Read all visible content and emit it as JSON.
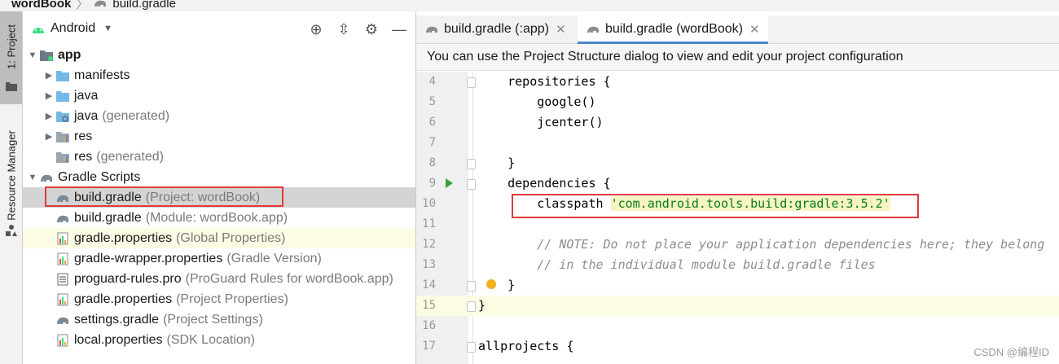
{
  "breadcrumb": {
    "project": "wordBook",
    "file": "build.gradle"
  },
  "toolstrip": {
    "project_tab": "1: Project",
    "resource_tab": "Resource Manager"
  },
  "project_panel": {
    "view_mode": "Android"
  },
  "tree": [
    {
      "label": "app",
      "note": "",
      "indent": 0,
      "arrow": "▼",
      "icon": "app-module-icon",
      "bold": true
    },
    {
      "label": "manifests",
      "note": "",
      "indent": 1,
      "arrow": "▶",
      "icon": "folder-icon"
    },
    {
      "label": "java",
      "note": "",
      "indent": 1,
      "arrow": "▶",
      "icon": "folder-icon"
    },
    {
      "label": "java",
      "note": "(generated)",
      "indent": 1,
      "arrow": "▶",
      "icon": "generated-folder-icon"
    },
    {
      "label": "res",
      "note": "",
      "indent": 1,
      "arrow": "▶",
      "icon": "res-folder-icon"
    },
    {
      "label": "res",
      "note": "(generated)",
      "indent": 1,
      "arrow": "",
      "icon": "res-folder-icon"
    },
    {
      "label": "Gradle Scripts",
      "note": "",
      "indent": 0,
      "arrow": "▼",
      "icon": "gradle-icon"
    },
    {
      "label": "build.gradle",
      "note": "(Project: wordBook)",
      "indent": 1,
      "arrow": "",
      "icon": "gradle-icon",
      "selected": true
    },
    {
      "label": "build.gradle",
      "note": "(Module: wordBook.app)",
      "indent": 1,
      "arrow": "",
      "icon": "gradle-icon"
    },
    {
      "label": "gradle.properties",
      "note": "(Global Properties)",
      "indent": 1,
      "arrow": "",
      "icon": "properties-icon",
      "highlight": true
    },
    {
      "label": "gradle-wrapper.properties",
      "note": "(Gradle Version)",
      "indent": 1,
      "arrow": "",
      "icon": "properties-icon"
    },
    {
      "label": "proguard-rules.pro",
      "note": "(ProGuard Rules for wordBook.app)",
      "indent": 1,
      "arrow": "",
      "icon": "file-icon"
    },
    {
      "label": "gradle.properties",
      "note": "(Project Properties)",
      "indent": 1,
      "arrow": "",
      "icon": "properties-icon"
    },
    {
      "label": "settings.gradle",
      "note": "(Project Settings)",
      "indent": 1,
      "arrow": "",
      "icon": "gradle-icon"
    },
    {
      "label": "local.properties",
      "note": "(SDK Location)",
      "indent": 1,
      "arrow": "",
      "icon": "properties-icon"
    }
  ],
  "editor": {
    "tabs": [
      {
        "label": "build.gradle (:app)",
        "active": false
      },
      {
        "label": "build.gradle (wordBook)",
        "active": true
      }
    ],
    "banner": "You can use the Project Structure dialog to view and edit your project configuration",
    "lines": [
      {
        "num": "4",
        "code": "    repositories {"
      },
      {
        "num": "5",
        "code": "        google()"
      },
      {
        "num": "6",
        "code": "        jcenter()"
      },
      {
        "num": "7",
        "code": ""
      },
      {
        "num": "8",
        "code": "    }"
      },
      {
        "num": "9",
        "code": "    dependencies {"
      },
      {
        "num": "10",
        "code": "        classpath ",
        "str": "'com.android.tools.build:gradle:3.5.2'"
      },
      {
        "num": "11",
        "code": ""
      },
      {
        "num": "12",
        "code": "",
        "comment": "        // NOTE: Do not place your application dependencies here; they belong"
      },
      {
        "num": "13",
        "code": "",
        "comment": "        // in the individual module build.gradle files"
      },
      {
        "num": "14",
        "code": "    }"
      },
      {
        "num": "15",
        "code": "}"
      },
      {
        "num": "16",
        "code": ""
      },
      {
        "num": "17",
        "code": "allprojects {"
      }
    ]
  },
  "watermark": "CSDN @编程ID",
  "colors": {
    "accent": "#4a86c7",
    "selection": "#d4d4d4",
    "highlight_box": "#e03a3a",
    "string": "#067d17",
    "comment": "#8c8c8c"
  }
}
